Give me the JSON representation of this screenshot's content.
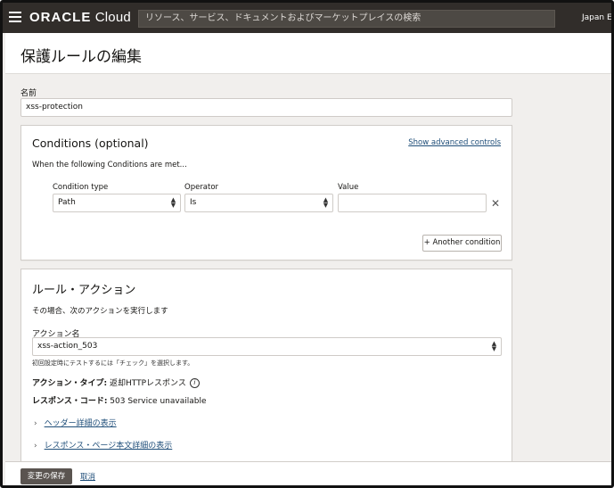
{
  "topbar": {
    "brand_oracle": "ORACLE",
    "brand_cloud": " Cloud",
    "search_placeholder": "リソース、サービス、ドキュメントおよびマーケットプレイスの検索",
    "region": "Japan Ea"
  },
  "page": {
    "title": "保護ルールの編集"
  },
  "name_field": {
    "label": "名前",
    "value": "xss-protection"
  },
  "conditions": {
    "title": "Conditions (optional)",
    "advanced_link": "Show advanced controls",
    "description": "When the following Conditions are met...",
    "condition_type_label": "Condition type",
    "operator_label": "Operator",
    "value_label": "Value",
    "condition_type_value": "Path",
    "operator_value": "Is",
    "value_value": "",
    "add_button": "+ Another condition"
  },
  "rule_action": {
    "title": "ルール・アクション",
    "description": "その場合、次のアクションを実行します",
    "action_name_label": "アクション名",
    "action_name_value": "xss-action_503",
    "helper": "初回設定時にテストするには「チェック」を選択します。",
    "action_type_key": "アクション・タイプ:",
    "action_type_value": " 返却HTTPレスポンス",
    "response_code_key": "レスポンス・コード:",
    "response_code_value": " 503 Service unavailable",
    "show_headers": "ヘッダー詳細の表示",
    "show_body": "レスポンス・ページ本文詳細の表示"
  },
  "footer": {
    "save": "変更の保存",
    "cancel": "取消"
  }
}
